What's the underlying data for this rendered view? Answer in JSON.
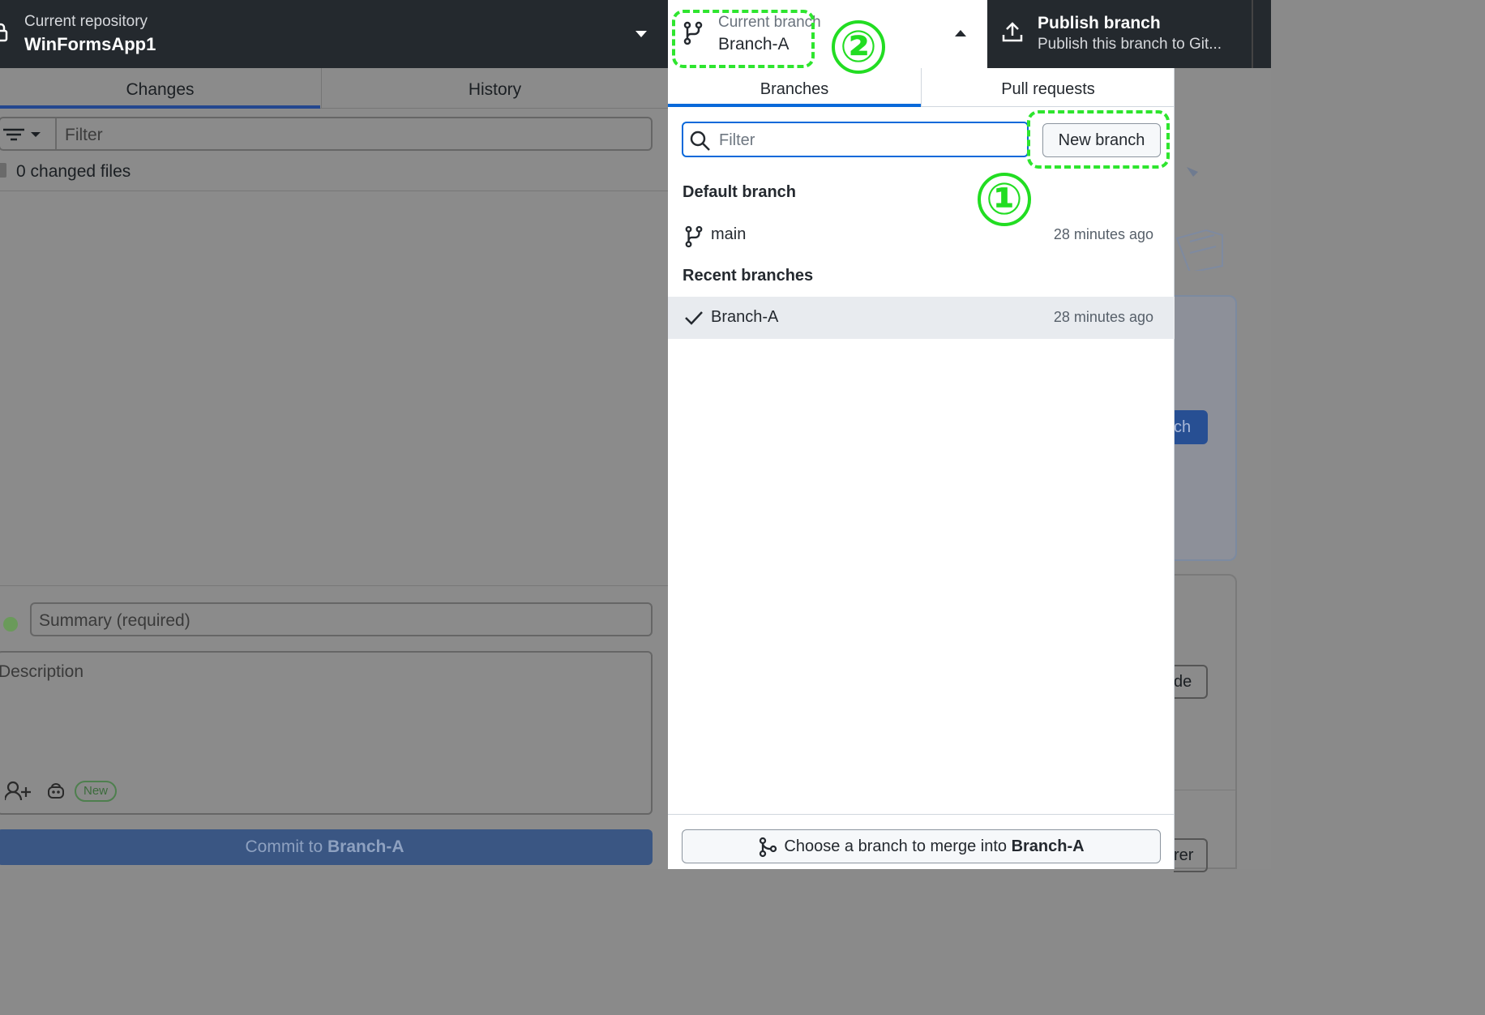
{
  "repo": {
    "label": "Current repository",
    "name": "WinFormsApp1"
  },
  "branch": {
    "label": "Current branch",
    "name": "Branch-A"
  },
  "publish": {
    "title": "Publish branch",
    "subtitle": "Publish this branch to Git..."
  },
  "left": {
    "tabs": [
      "Changes",
      "History"
    ],
    "filter_placeholder": "Filter",
    "changed_files": "0 changed files",
    "summary_placeholder": "Summary (required)",
    "description_placeholder": "Description",
    "new_badge": "New",
    "commit_prefix": "Commit to ",
    "commit_branch": "Branch-A"
  },
  "dropdown": {
    "tabs": [
      "Branches",
      "Pull requests"
    ],
    "filter_placeholder": "Filter",
    "new_branch": "New branch",
    "default_section": "Default branch",
    "recent_section": "Recent branches",
    "branches": [
      {
        "name": "main",
        "time": "28 minutes ago"
      },
      {
        "name": "Branch-A",
        "time": "28 minutes ago"
      }
    ],
    "merge_prefix": "Choose a branch to merge into ",
    "merge_branch": "Branch-A"
  },
  "background_right": {
    "btn1": "ch",
    "btn2": "de",
    "btn3": "rer"
  },
  "annotations": {
    "one": "①",
    "two": "②"
  },
  "colors": {
    "accent": "#0969da",
    "annotation": "#22dd22",
    "topbar": "#24292e"
  }
}
